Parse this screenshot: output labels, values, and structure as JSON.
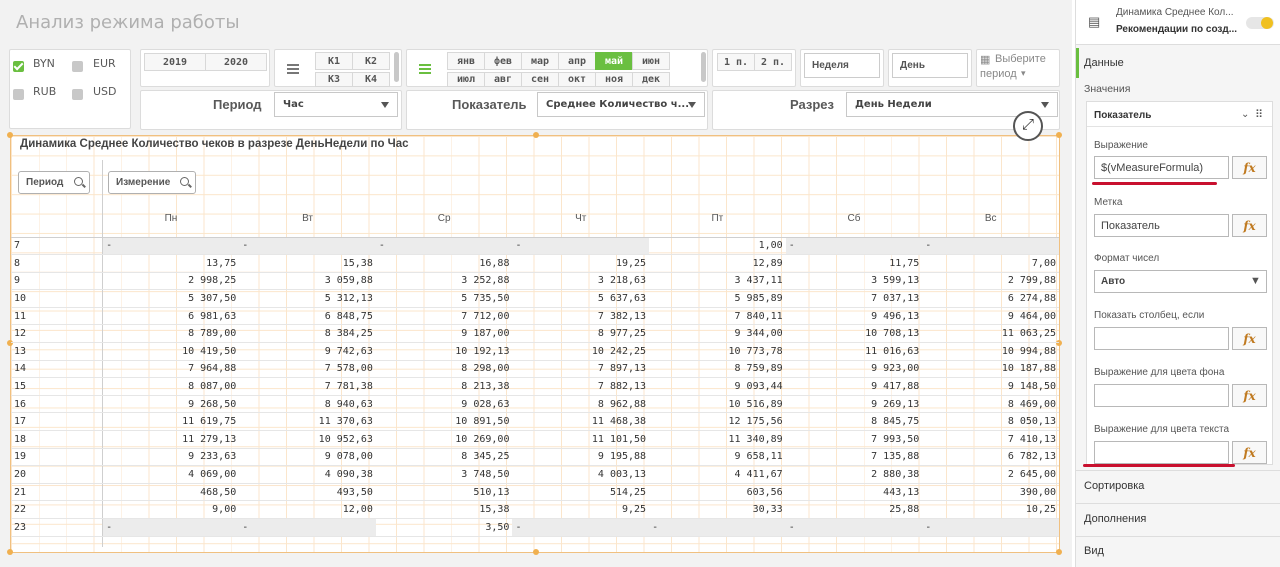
{
  "app": {
    "title": "Анализ режима работы"
  },
  "currency": {
    "items": [
      {
        "label": "BYN",
        "checked": true
      },
      {
        "label": "EUR",
        "checked": false
      },
      {
        "label": "RUB",
        "checked": false
      },
      {
        "label": "USD",
        "checked": false
      }
    ]
  },
  "years": [
    "2019",
    "2020"
  ],
  "quarters": [
    "K1",
    "K2",
    "K3",
    "K4"
  ],
  "months": {
    "row1": [
      "янв",
      "фев",
      "мар",
      "апр",
      "май",
      "июн"
    ],
    "row2": [
      "июл",
      "авг",
      "сен",
      "окт",
      "ноя",
      "дек"
    ],
    "selected": "май"
  },
  "halves": [
    "1 п.",
    "2 п."
  ],
  "week_label": "Неделя",
  "day_label": "День",
  "choose_period": {
    "line1": "Выберите",
    "line2": "период"
  },
  "period": {
    "label": "Период",
    "value": "Час"
  },
  "indicator": {
    "label": "Показатель",
    "value": "Среднее Количество ч..."
  },
  "section": {
    "label": "Разрез",
    "value": "День Недели"
  },
  "table_chart": {
    "title": "Динамика Среднее Количество чеков в разрезе ДеньНедели по Час",
    "dim_search": "Период",
    "measure_search": "Измерение",
    "columns": [
      "Пн",
      "Вт",
      "Ср",
      "Чт",
      "Пт",
      "Сб",
      "Вс"
    ],
    "rows": [
      {
        "h": "7",
        "v": [
          "-",
          "-",
          "-",
          "-",
          "1,00",
          "-",
          "-"
        ]
      },
      {
        "h": "8",
        "v": [
          "13,75",
          "15,38",
          "16,88",
          "19,25",
          "12,89",
          "11,75",
          "7,00"
        ]
      },
      {
        "h": "9",
        "v": [
          "2 998,25",
          "3 059,88",
          "3 252,88",
          "3 218,63",
          "3 437,11",
          "3 599,13",
          "2 799,88"
        ]
      },
      {
        "h": "10",
        "v": [
          "5 307,50",
          "5 312,13",
          "5 735,50",
          "5 637,63",
          "5 985,89",
          "7 037,13",
          "6 274,88"
        ]
      },
      {
        "h": "11",
        "v": [
          "6 981,63",
          "6 848,75",
          "7 712,00",
          "7 382,13",
          "7 840,11",
          "9 496,13",
          "9 464,00"
        ]
      },
      {
        "h": "12",
        "v": [
          "8 789,00",
          "8 384,25",
          "9 187,00",
          "8 977,25",
          "9 344,00",
          "10 708,13",
          "11 063,25"
        ]
      },
      {
        "h": "13",
        "v": [
          "10 419,50",
          "9 742,63",
          "10 192,13",
          "10 242,25",
          "10 773,78",
          "11 016,63",
          "10 994,88"
        ]
      },
      {
        "h": "14",
        "v": [
          "7 964,88",
          "7 578,00",
          "8 298,00",
          "7 897,13",
          "8 759,89",
          "9 923,00",
          "10 187,88"
        ]
      },
      {
        "h": "15",
        "v": [
          "8 087,00",
          "7 781,38",
          "8 213,38",
          "7 882,13",
          "9 093,44",
          "9 417,88",
          "9 148,50"
        ]
      },
      {
        "h": "16",
        "v": [
          "9 268,50",
          "8 940,63",
          "9 028,63",
          "8 962,88",
          "10 516,89",
          "9 269,13",
          "8 469,00"
        ]
      },
      {
        "h": "17",
        "v": [
          "11 619,75",
          "11 370,63",
          "10 891,50",
          "11 468,38",
          "12 175,56",
          "8 845,75",
          "8 050,13"
        ]
      },
      {
        "h": "18",
        "v": [
          "11 279,13",
          "10 952,63",
          "10 269,00",
          "11 101,50",
          "11 340,89",
          "7 993,50",
          "7 410,13"
        ]
      },
      {
        "h": "19",
        "v": [
          "9 233,63",
          "9 078,00",
          "8 345,25",
          "9 195,88",
          "9 658,11",
          "7 135,88",
          "6 782,13"
        ]
      },
      {
        "h": "20",
        "v": [
          "4 069,00",
          "4 090,38",
          "3 748,50",
          "4 003,13",
          "4 411,67",
          "2 880,38",
          "2 645,00"
        ]
      },
      {
        "h": "21",
        "v": [
          "468,50",
          "493,50",
          "510,13",
          "514,25",
          "603,56",
          "443,13",
          "390,00"
        ]
      },
      {
        "h": "22",
        "v": [
          "9,00",
          "12,00",
          "15,38",
          "9,25",
          "30,33",
          "25,88",
          "10,25"
        ]
      },
      {
        "h": "23",
        "v": [
          "-",
          "-",
          "3,50",
          "-",
          "-",
          "-",
          "-"
        ]
      }
    ]
  },
  "panel": {
    "chart_name": "Динамика Среднее Кол...",
    "chart_sub": "Рекомендации по созд...",
    "data_tab": "Данные",
    "values_label": "Значения",
    "measure_title": "Показатель",
    "expr_label": "Выражение",
    "expr_value": "$(vMeasureFormula)",
    "label_label": "Метка",
    "label_value": "Показатель",
    "numfmt_label": "Формат чисел",
    "numfmt_value": "Авто",
    "showcol_label": "Показать столбец, если",
    "bgcolor_label": "Выражение для цвета фона",
    "txtcolor_label": "Выражение для цвета текста",
    "fx": "fx",
    "sections": [
      "Сортировка",
      "Дополнения",
      "Вид"
    ]
  }
}
